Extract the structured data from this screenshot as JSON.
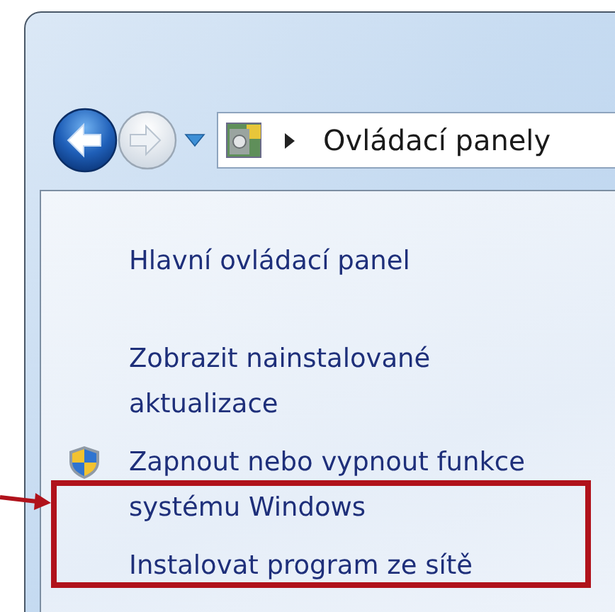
{
  "navigation": {
    "back_button": {
      "disabled": false
    },
    "forward_button": {
      "disabled": true
    }
  },
  "address_bar": {
    "breadcrumb": "Ovládací panely"
  },
  "sidebar": {
    "links": [
      {
        "label": "Hlavní ovládací panel",
        "kind": "link"
      },
      {
        "label": "Zobrazit nainstalované aktualizace",
        "kind": "link"
      },
      {
        "label": "Zapnout nebo vypnout funkce systému Windows",
        "kind": "shield-link"
      },
      {
        "label": "Instalovat program ze sítě",
        "kind": "link"
      }
    ]
  }
}
